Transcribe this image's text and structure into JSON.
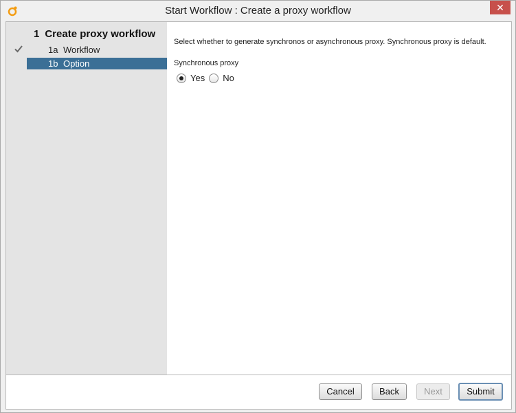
{
  "window": {
    "title": "Start Workflow : Create a proxy workflow",
    "close_glyph": "✕",
    "accent": "#c7504b"
  },
  "sidebar": {
    "step": {
      "number": "1",
      "label": "Create proxy workflow"
    },
    "substeps": [
      {
        "number": "1a",
        "label": "Workflow",
        "completed": true
      },
      {
        "number": "1b",
        "label": "Option",
        "selected": true
      }
    ]
  },
  "content": {
    "description": "Select whether to generate synchronos or asynchronous proxy. Synchronous proxy is default.",
    "field_label": "Synchronous proxy",
    "options": [
      {
        "label": "Yes",
        "checked": true
      },
      {
        "label": "No",
        "checked": false
      }
    ]
  },
  "buttons": {
    "cancel": "Cancel",
    "back": "Back",
    "next": "Next",
    "submit": "Submit"
  },
  "colors": {
    "selection": "#3b6f96",
    "sidebar_bg": "#e4e4e4"
  }
}
